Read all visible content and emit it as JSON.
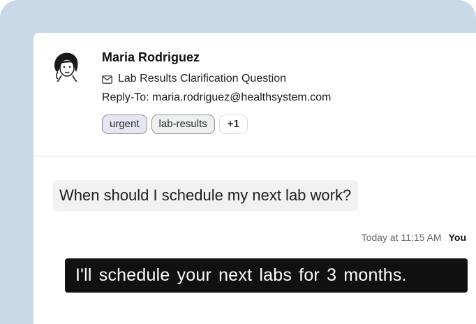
{
  "email": {
    "sender_name": "Maria Rodriguez",
    "subject": "Lab Results Clarification Question",
    "reply_to_label": "Reply-To:",
    "reply_to_address": "maria.rodriguez@healthsystem.com",
    "tags": [
      "urgent",
      "lab-results",
      "+1"
    ]
  },
  "conversation": {
    "incoming_message": "When should I schedule my next lab work?",
    "timestamp": "Today at 11:15 AM",
    "author": "You",
    "outgoing_message": "I'll schedule your next labs for 3 months."
  },
  "icons": {
    "avatar": "woman-portrait-illustration",
    "subject": "envelope-icon"
  },
  "colors": {
    "frame_background": "#c9d9e8",
    "tag_urgent_bg": "#e6e5f2",
    "tag_lab_bg": "#edf0ee",
    "outgoing_bubble": "#111111",
    "incoming_bubble": "#f1f1f1"
  }
}
